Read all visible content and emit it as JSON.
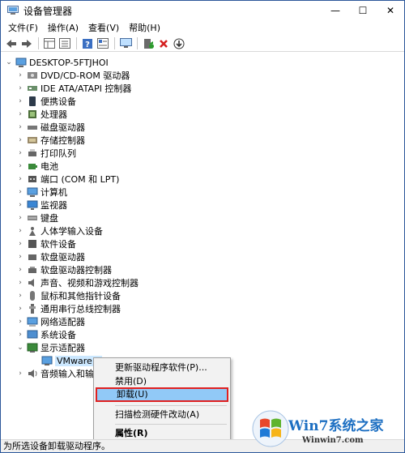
{
  "window": {
    "title": "设备管理器"
  },
  "menu": [
    "文件(F)",
    "操作(A)",
    "查看(V)",
    "帮助(H)"
  ],
  "toolbar_icons": [
    "back-icon",
    "forward-icon",
    "properties-grid-icon",
    "list-icon",
    "help-icon",
    "details-icon",
    "monitor-scan-icon",
    "enable-device-icon",
    "uninstall-x-icon",
    "update-driver-icon"
  ],
  "tree": {
    "root": "DESKTOP-5FTJHOI",
    "categories": [
      "DVD/CD-ROM 驱动器",
      "IDE ATA/ATAPI 控制器",
      "便携设备",
      "处理器",
      "磁盘驱动器",
      "存储控制器",
      "打印队列",
      "电池",
      "端口 (COM 和 LPT)",
      "计算机",
      "监视器",
      "键盘",
      "人体学输入设备",
      "软件设备",
      "软盘驱动器",
      "软盘驱动器控制器",
      "声音、视频和游戏控制器",
      "鼠标和其他指针设备",
      "通用串行总线控制器",
      "网络适配器",
      "系统设备",
      "显示适配器"
    ],
    "expanded_child": "VMware S",
    "after": "音频输入和输出"
  },
  "context_menu": {
    "items": [
      "更新驱动程序软件(P)...",
      "禁用(D)",
      "卸载(U)",
      "扫描检测硬件改动(A)",
      "属性(R)"
    ],
    "highlighted": "卸载(U)"
  },
  "status": "为所选设备卸载驱动程序。",
  "watermark": {
    "brand": "Win7系统之家",
    "url": "Winwin7.com"
  },
  "colors": {
    "selection": "#cce8ff",
    "menu_highlight": "#91c9f7",
    "outline_red": "#e02020",
    "brand_blue": "#1d6fc2"
  }
}
